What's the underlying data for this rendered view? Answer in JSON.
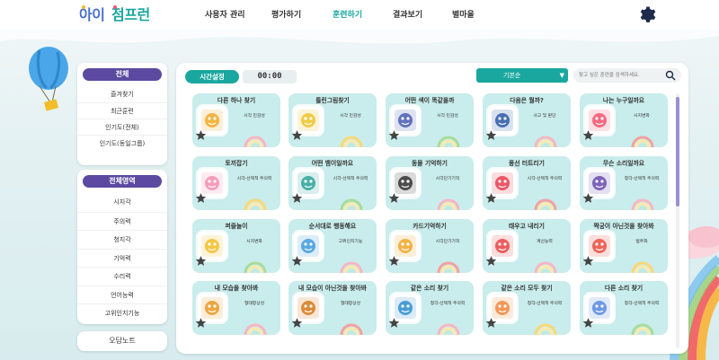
{
  "header": {
    "logo": "아이 점프런",
    "nav": [
      {
        "label": "사용자 관리",
        "active": false
      },
      {
        "label": "평가하기",
        "active": false
      },
      {
        "label": "훈련하기",
        "active": true
      },
      {
        "label": "결과보기",
        "active": false
      },
      {
        "label": "별마을",
        "active": false
      }
    ],
    "settings_icon": "gear-icon"
  },
  "sidebar": {
    "section1": {
      "title": "전체",
      "items": [
        "즐겨찾기",
        "최근훈련",
        "인기도(전체)",
        "인기도(동일그룹)"
      ]
    },
    "section2": {
      "title": "전체영역",
      "items": [
        "시지각",
        "주의력",
        "청지각",
        "기억력",
        "수리력",
        "언어능력",
        "고위인지기능"
      ]
    },
    "wrong_note": "오답노트"
  },
  "toolbar": {
    "timer_label": "시간설정",
    "timer_value": "00:00",
    "sort_value": "기본순",
    "search_placeholder": "찾고 싶은 훈련을 검색하세요."
  },
  "cards": [
    {
      "title": "다른 하나 찾기",
      "category": "시각 민감성",
      "icon": "stars-icon",
      "color": "#f1a928"
    },
    {
      "title": "틀린그림찾기",
      "category": "시각 민감성",
      "icon": "magnifier-icon",
      "color": "#f1c22a"
    },
    {
      "title": "어떤 색이 똑같을까",
      "category": "시각 민감성",
      "icon": "palette-icon",
      "color": "#4a5fb3"
    },
    {
      "title": "다음은 뭘까?",
      "category": "사고 및 판단",
      "icon": "numbers-icon",
      "color": "#2d5ba8"
    },
    {
      "title": "나는 누구일까요",
      "category": "시지변화",
      "icon": "pig-icon",
      "color": "#f2556f"
    },
    {
      "title": "토끼잡기",
      "category": "시각-선택적 주의력",
      "icon": "rabbit-icon",
      "color": "#f58fb0"
    },
    {
      "title": "어떤 뱀이일까요",
      "category": "시각-선택적 주의력",
      "icon": "snake-icon",
      "color": "#2fa39a"
    },
    {
      "title": "동물 기억하기",
      "category": "시각단기기억",
      "icon": "panda-icon",
      "color": "#333333"
    },
    {
      "title": "풍선 터트리기",
      "category": "시각-선택적 주의력",
      "icon": "balloons-icon",
      "color": "#ea4050"
    },
    {
      "title": "무슨 소리일까요",
      "category": "청각-선택적 주의력",
      "icon": "headphones-icon",
      "color": "#6a4fb0"
    },
    {
      "title": "퍼즐놀이",
      "category": "시지변화",
      "icon": "puzzle-icon",
      "color": "#f2bd28"
    },
    {
      "title": "순서대로 행동해요",
      "category": "고위인지기능",
      "icon": "blocks-icon",
      "color": "#3f9be0"
    },
    {
      "title": "카드기억하기",
      "category": "시각단기기억",
      "icon": "cards-icon",
      "color": "#f0a82a"
    },
    {
      "title": "태우고 내리기",
      "category": "계산능력",
      "icon": "arrows-icon",
      "color": "#e84848"
    },
    {
      "title": "짝궁이 아닌것을 찾아봐",
      "category": "범주화",
      "icon": "ball-icon",
      "color": "#ea5040"
    },
    {
      "title": "내 모습을 찾아봐",
      "category": "형태항상성",
      "icon": "lion-icon",
      "color": "#e89a28"
    },
    {
      "title": "내 모습이 아닌것을 찾아봐",
      "category": "형태항상성",
      "icon": "lion-icon",
      "color": "#d67a20"
    },
    {
      "title": "같은 소리 찾기",
      "category": "청각-선택적 주의력",
      "icon": "music-note-icon",
      "color": "#2f8fd0"
    },
    {
      "title": "같은 소리 모두 찾기",
      "category": "청각-선택적 주의력",
      "icon": "music-notes-icon",
      "color": "#f08a40"
    },
    {
      "title": "다른 소리 찾기",
      "category": "청각-선택적 주의력",
      "icon": "music-notes-icon",
      "color": "#5a8ae0"
    }
  ],
  "colors": {
    "accent": "#1aa79f",
    "sidebar_head": "#5b4aa0",
    "card_bg": "#c9ecec",
    "nav_active": "#19a6a0"
  }
}
